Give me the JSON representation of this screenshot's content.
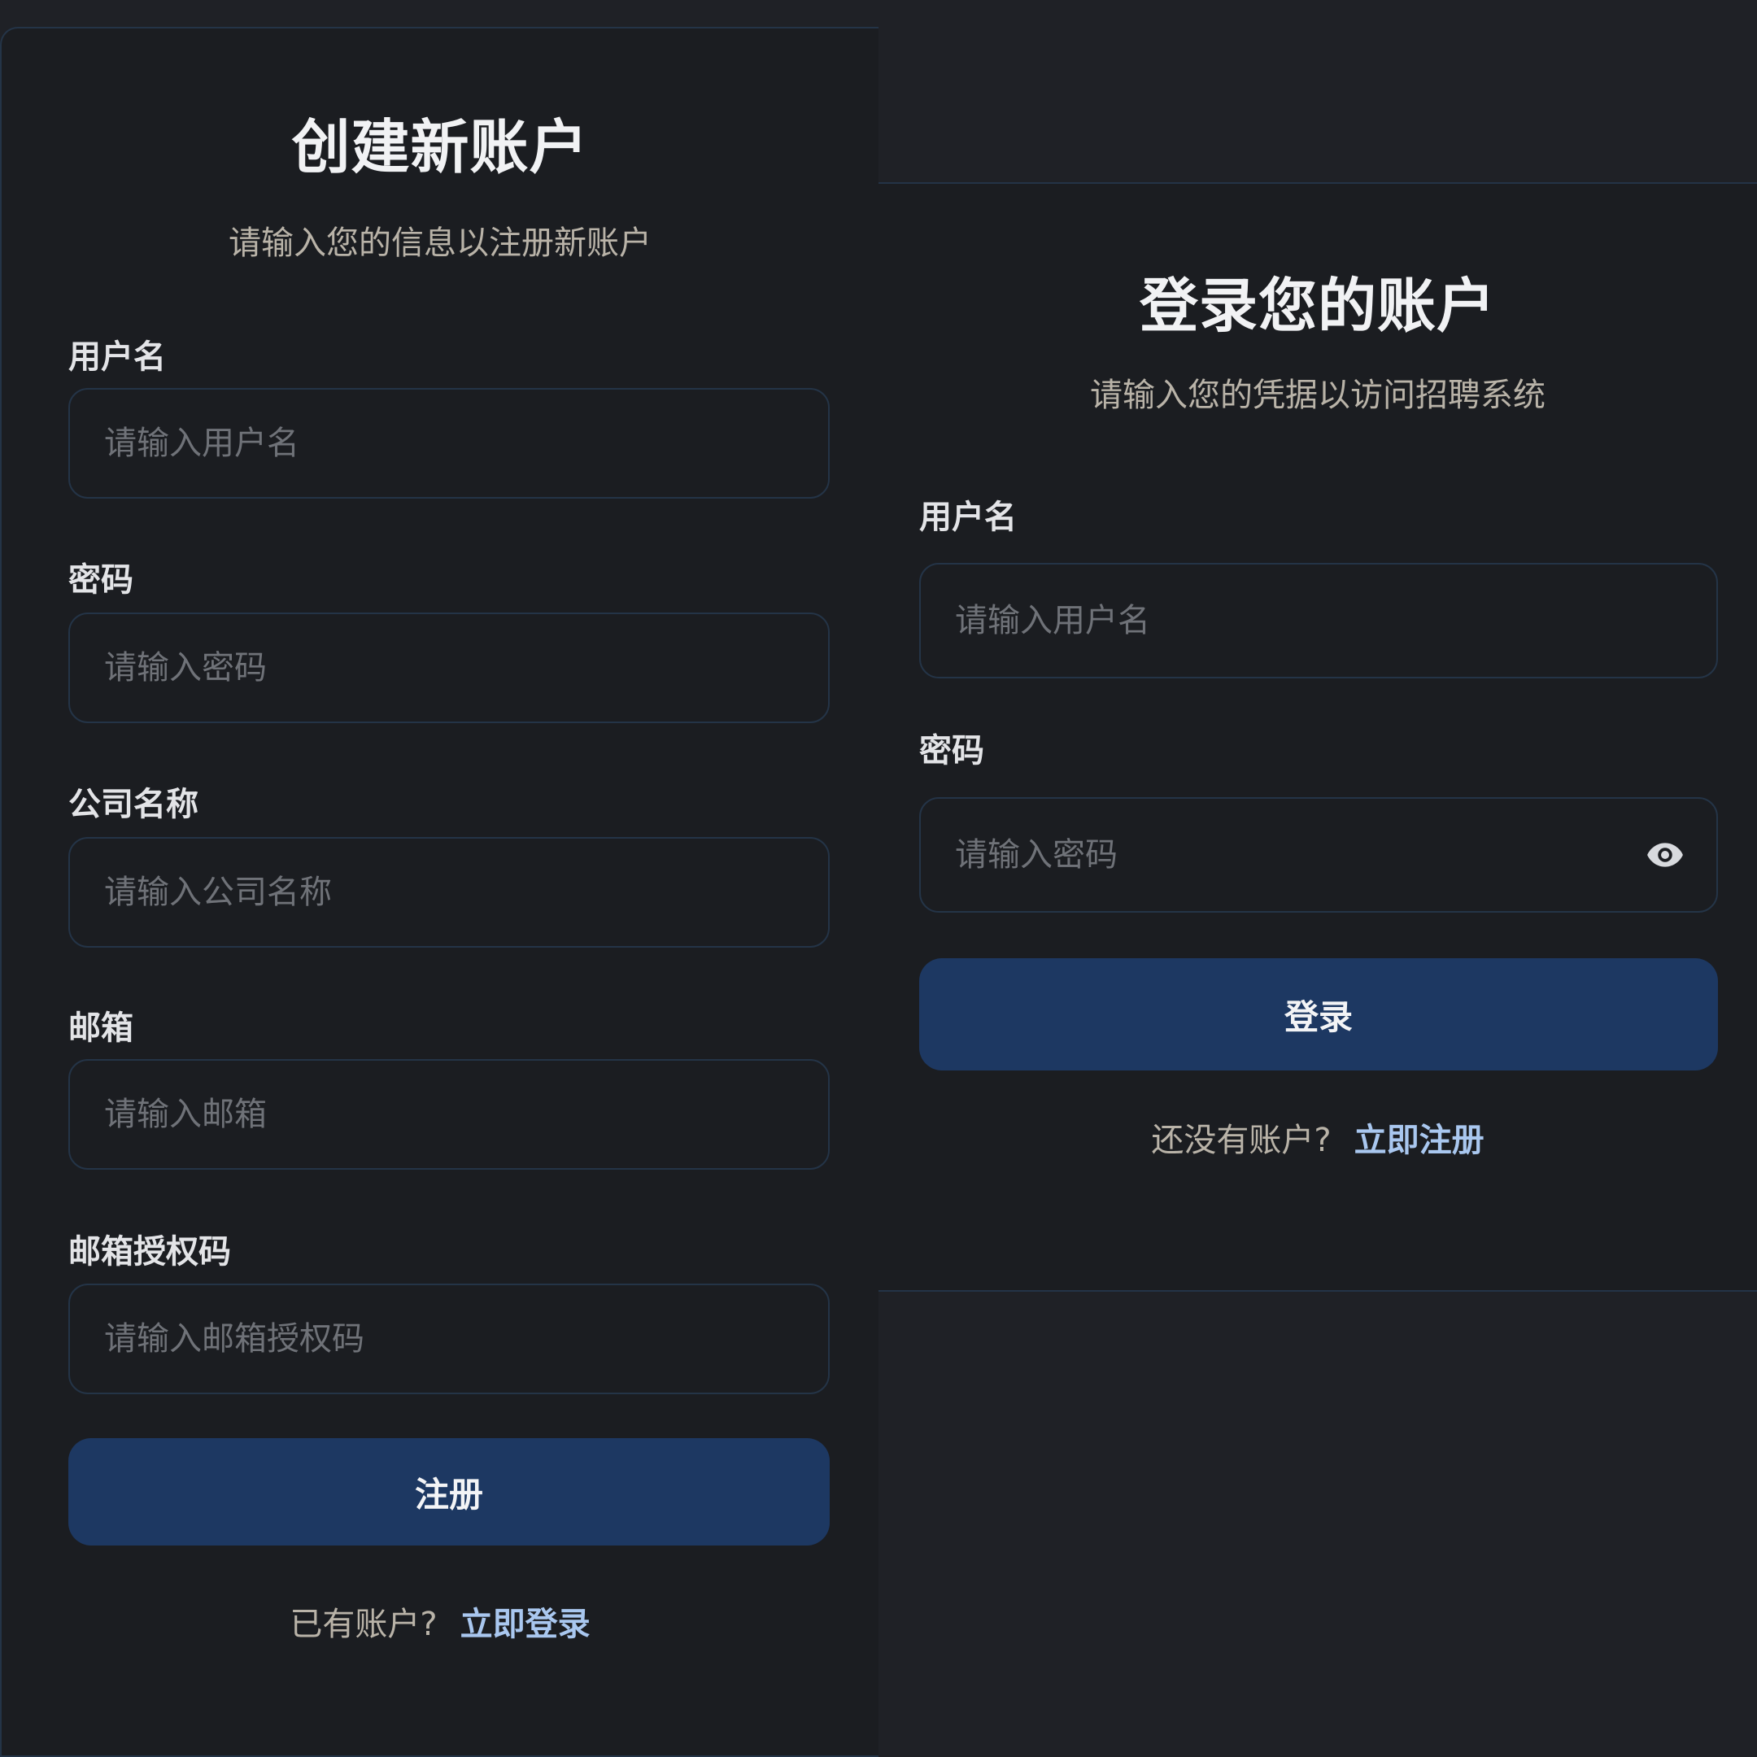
{
  "register": {
    "title": "创建新账户",
    "subtitle": "请输入您的信息以注册新账户",
    "fields": [
      {
        "label": "用户名",
        "placeholder": "请输入用户名",
        "value": ""
      },
      {
        "label": "密码",
        "placeholder": "请输入密码",
        "value": ""
      },
      {
        "label": "公司名称",
        "placeholder": "请输入公司名称",
        "value": ""
      },
      {
        "label": "邮箱",
        "placeholder": "请输入邮箱",
        "value": ""
      },
      {
        "label": "邮箱授权码",
        "placeholder": "请输入邮箱授权码",
        "value": ""
      }
    ],
    "submit_label": "注册",
    "footer_text": "已有账户?",
    "footer_link": "立即登录"
  },
  "login": {
    "title": "登录您的账户",
    "subtitle": "请输入您的凭据以访问招聘系统",
    "fields": [
      {
        "label": "用户名",
        "placeholder": "请输入用户名",
        "value": ""
      },
      {
        "label": "密码",
        "placeholder": "请输入密码",
        "value": ""
      }
    ],
    "password_toggle_icon": "eye-icon",
    "submit_label": "登录",
    "footer_text": "还没有账户?",
    "footer_link": "立即注册"
  },
  "colors": {
    "background": "#1f2126",
    "card": "#1b1d21",
    "border": "#243447",
    "primary": "#1d3862",
    "link": "#a9c7ef",
    "muted_text": "#b9b3a8",
    "placeholder": "#6f7278"
  }
}
